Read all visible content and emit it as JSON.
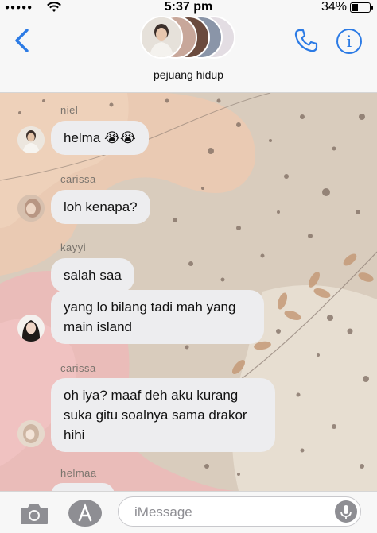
{
  "status_bar": {
    "signal": "●●●●●",
    "time": "5:37 pm",
    "battery": "34%"
  },
  "header": {
    "group_name": "pejuang hidup",
    "back_icon": "chevron-left-icon",
    "call_icon": "phone-icon",
    "info_icon": "info-icon",
    "info_glyph": "i",
    "accent": "#2c7be5"
  },
  "messages": [
    {
      "sender": "niel",
      "text": "helma 😭😭"
    },
    {
      "sender": "carissa",
      "text": "loh kenapa?"
    },
    {
      "sender": "kayyi",
      "text": "salah saa"
    },
    {
      "sender": "",
      "text": "yang lo bilang tadi mah yang main island"
    },
    {
      "sender": "carissa",
      "text": "oh iya? maaf deh aku kurang suka gitu soalnya sama drakor hihi"
    },
    {
      "sender": "helmaa",
      "text": ""
    }
  ],
  "input": {
    "placeholder": "iMessage",
    "camera_icon": "camera-icon",
    "apps_icon": "app-store-icon",
    "mic_icon": "microphone-icon"
  }
}
